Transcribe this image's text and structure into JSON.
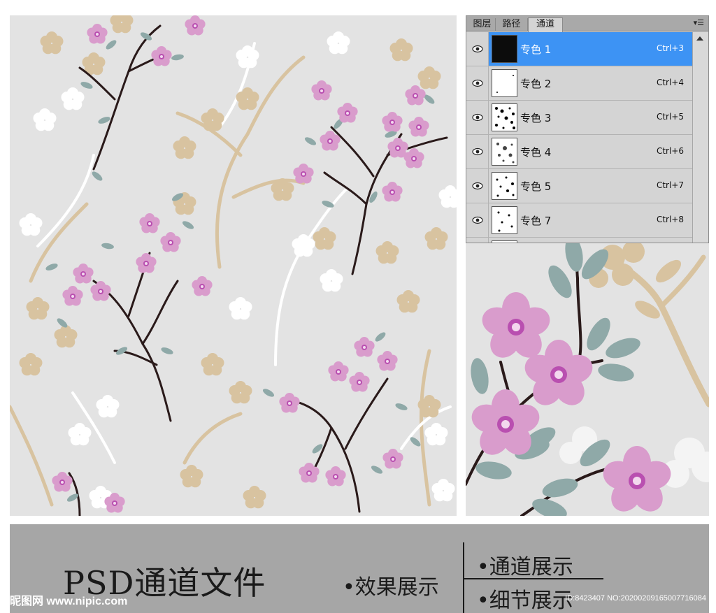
{
  "channels_panel": {
    "tabs": [
      {
        "label": "图层",
        "active": false
      },
      {
        "label": "路径",
        "active": false
      },
      {
        "label": "通道",
        "active": true
      }
    ],
    "menu_icon": "panel-menu-icon",
    "channels": [
      {
        "name": "专色 1",
        "shortcut": "Ctrl+3",
        "selected": true
      },
      {
        "name": "专色 2",
        "shortcut": "Ctrl+4",
        "selected": false
      },
      {
        "name": "专色 3",
        "shortcut": "Ctrl+5",
        "selected": false
      },
      {
        "name": "专色 4",
        "shortcut": "Ctrl+6",
        "selected": false
      },
      {
        "name": "专色 5",
        "shortcut": "Ctrl+7",
        "selected": false
      },
      {
        "name": "专色 7",
        "shortcut": "Ctrl+8",
        "selected": false
      }
    ]
  },
  "banner": {
    "title": "PSD通道文件",
    "feature_effect": "•效果展示",
    "feature_channels": "•通道展示",
    "feature_detail": "•细节展示",
    "watermark_left": "昵图网 www.nipic.com",
    "watermark_right": "ID:8423407 NO:20200209165007716084"
  },
  "colors": {
    "background": "#e3e3e3",
    "blossom_pink": "#d99ccc",
    "blossom_center": "#b94fb0",
    "leaf_teal": "#8fa9a8",
    "leaf_tan": "#d8c3a0",
    "branch_dark": "#2a1a1a",
    "selection_blue": "#3d93f4",
    "banner_gray": "#a6a6a6"
  }
}
